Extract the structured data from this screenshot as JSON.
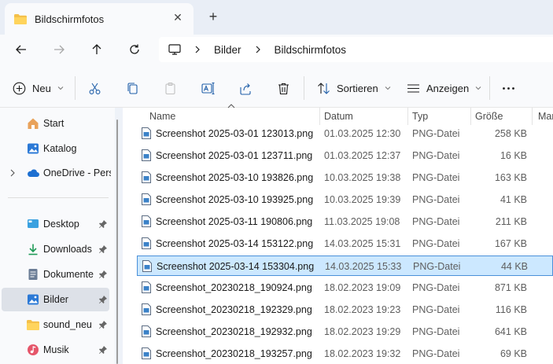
{
  "tab": {
    "title": "Bildschirmfotos"
  },
  "breadcrumb": [
    "Bilder",
    "Bildschirmfotos"
  ],
  "toolbar": {
    "new_label": "Neu",
    "sort_label": "Sortieren",
    "view_label": "Anzeigen"
  },
  "sidebar": {
    "items": [
      {
        "label": "Start"
      },
      {
        "label": "Katalog"
      },
      {
        "label": "OneDrive - Perso"
      },
      {
        "label": "Desktop"
      },
      {
        "label": "Downloads"
      },
      {
        "label": "Dokumente"
      },
      {
        "label": "Bilder"
      },
      {
        "label": "sound_neu"
      },
      {
        "label": "Musik"
      }
    ]
  },
  "columns": {
    "name": "Name",
    "date": "Datum",
    "type": "Typ",
    "size": "Größe",
    "more": "Mar"
  },
  "files": [
    {
      "name": "Screenshot 2025-03-01 123013.png",
      "date": "01.03.2025 12:30",
      "type": "PNG-Datei",
      "size": "258 KB"
    },
    {
      "name": "Screenshot 2025-03-01 123711.png",
      "date": "01.03.2025 12:37",
      "type": "PNG-Datei",
      "size": "16 KB"
    },
    {
      "name": "Screenshot 2025-03-10 193826.png",
      "date": "10.03.2025 19:38",
      "type": "PNG-Datei",
      "size": "163 KB"
    },
    {
      "name": "Screenshot 2025-03-10 193925.png",
      "date": "10.03.2025 19:39",
      "type": "PNG-Datei",
      "size": "41 KB"
    },
    {
      "name": "Screenshot 2025-03-11 190806.png",
      "date": "11.03.2025 19:08",
      "type": "PNG-Datei",
      "size": "211 KB"
    },
    {
      "name": "Screenshot 2025-03-14 153122.png",
      "date": "14.03.2025 15:31",
      "type": "PNG-Datei",
      "size": "167 KB"
    },
    {
      "name": "Screenshot 2025-03-14 153304.png",
      "date": "14.03.2025 15:33",
      "type": "PNG-Datei",
      "size": "44 KB",
      "selected": true
    },
    {
      "name": "Screenshot_20230218_190924.png",
      "date": "18.02.2023 19:09",
      "type": "PNG-Datei",
      "size": "871 KB"
    },
    {
      "name": "Screenshot_20230218_192329.png",
      "date": "18.02.2023 19:23",
      "type": "PNG-Datei",
      "size": "116 KB"
    },
    {
      "name": "Screenshot_20230218_192932.png",
      "date": "18.02.2023 19:29",
      "type": "PNG-Datei",
      "size": "641 KB"
    },
    {
      "name": "Screenshot_20230218_193257.png",
      "date": "18.02.2023 19:32",
      "type": "PNG-Datei",
      "size": "69 KB"
    }
  ]
}
